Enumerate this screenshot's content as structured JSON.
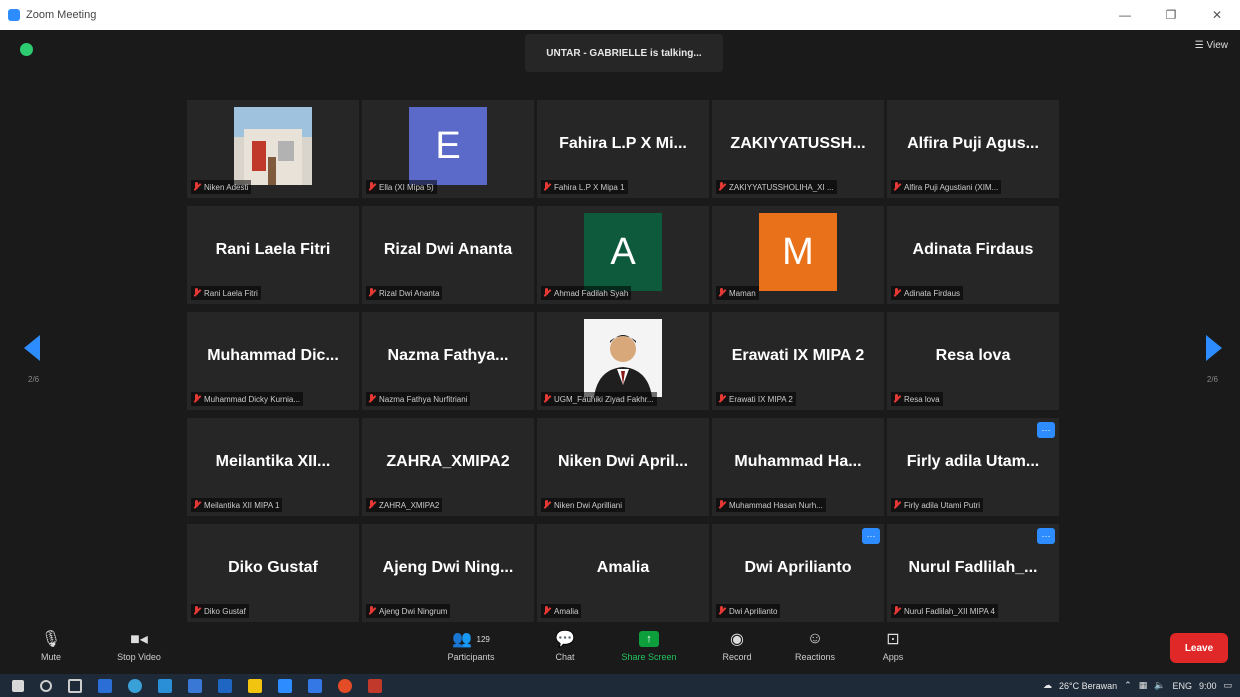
{
  "window": {
    "title": "Zoom Meeting",
    "controls": {
      "minimize": "—",
      "restore": "❐",
      "close": "✕"
    }
  },
  "meeting": {
    "talking_indicator": "UNTAR - GABRIELLE is talking...",
    "view_label": "View",
    "page_left": "2/6",
    "page_right": "2/6"
  },
  "colors": {
    "accent": "#2d8cff",
    "leave": "#e02828",
    "share": "#0e9f3d",
    "tile_bg": "#262626"
  },
  "participants": [
    {
      "display": "photo",
      "photo": "house",
      "label": "Niken Adesti"
    },
    {
      "display": "letter",
      "letter": "E",
      "color": "#5b6ac9",
      "label": "Ella (XI Mipa 5)"
    },
    {
      "display": "name",
      "name": "Fahira L.P X Mi...",
      "label": "Fahira L.P X Mipa 1"
    },
    {
      "display": "name",
      "name": "ZAKIYYATUSSH...",
      "label": "ZAKIYYATUSSHOLIHA_XI ..."
    },
    {
      "display": "name",
      "name": "Alfira Puji Agus...",
      "label": "Alfira Puji Agustiani (XIM..."
    },
    {
      "display": "name",
      "name": "Rani Laela Fitri",
      "label": "Rani Laela Fitri"
    },
    {
      "display": "name",
      "name": "Rizal Dwi Ananta",
      "label": "Rizal Dwi Ananta"
    },
    {
      "display": "letter",
      "letter": "A",
      "color": "#0d5b3c",
      "label": "Ahmad Fadilah Syah"
    },
    {
      "display": "letter",
      "letter": "M",
      "color": "#e8711a",
      "label": "Maman"
    },
    {
      "display": "name",
      "name": "Adinata Firdaus",
      "label": "Adinata Firdaus"
    },
    {
      "display": "name",
      "name": "Muhammad Dic...",
      "label": "Muhammad Dicky Kurnia..."
    },
    {
      "display": "name",
      "name": "Nazma Fathya...",
      "label": "Nazma Fathya Nurfitriani"
    },
    {
      "display": "photo",
      "photo": "portrait",
      "label": "UGM_Fauhiki Ziyad Fakhr..."
    },
    {
      "display": "name",
      "name": "Erawati IX MIPA 2",
      "label": "Erawati IX MIPA 2"
    },
    {
      "display": "name",
      "name": "Resa lova",
      "label": "Resa lova"
    },
    {
      "display": "name",
      "name": "Meilantika XII...",
      "label": "Meilantika XII MIPA 1"
    },
    {
      "display": "name",
      "name": "ZAHRA_XMIPA2",
      "label": "ZAHRA_XMIPA2"
    },
    {
      "display": "name",
      "name": "Niken Dwi April...",
      "label": "Niken Dwi Aprilliani"
    },
    {
      "display": "name",
      "name": "Muhammad Ha...",
      "label": "Muhammad Hasan Nurh..."
    },
    {
      "display": "name",
      "name": "Firly adila Utam...",
      "label": "Firly adila Utami Putri",
      "more": true
    },
    {
      "display": "name",
      "name": "Diko Gustaf",
      "label": "Diko Gustaf"
    },
    {
      "display": "name",
      "name": "Ajeng Dwi Ning...",
      "label": "Ajeng Dwi Ningrum"
    },
    {
      "display": "name",
      "name": "Amalia",
      "label": "Amalia"
    },
    {
      "display": "name",
      "name": "Dwi Aprilianto",
      "label": "Dwi Aprilianto",
      "more": true
    },
    {
      "display": "name",
      "name": "Nurul Fadlilah_...",
      "label": "Nurul Fadlilah_XII MIPA 4",
      "more": true
    }
  ],
  "toolbar": {
    "mute": "Mute",
    "stop_video": "Stop Video",
    "participants": "Participants",
    "participants_count": "129",
    "chat": "Chat",
    "share_screen": "Share Screen",
    "record": "Record",
    "reactions": "Reactions",
    "apps": "Apps",
    "leave": "Leave"
  },
  "taskbar": {
    "weather": "26°C  Berawan",
    "language": "ENG",
    "time": "9:00"
  }
}
